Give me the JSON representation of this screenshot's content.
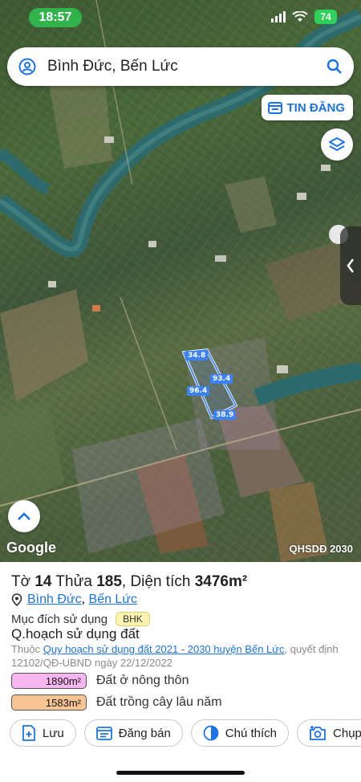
{
  "status_bar": {
    "time": "18:57",
    "battery": "74"
  },
  "search": {
    "value": "Bình Đức, Bến Lức"
  },
  "map": {
    "tin_dang_label": "TIN ĐĂNG",
    "google_label": "Google",
    "layer_label": "QHSDĐ 2030",
    "edge_labels": [
      "34.8",
      "93.4",
      "96.4",
      "38.9"
    ],
    "colors": {
      "accent": "#1a73e8",
      "parcel_outline": "#3b82f6",
      "river": "#2d6a6e"
    }
  },
  "parcel": {
    "title_prefix": "Tờ ",
    "sheet": "14",
    "title_mid": " Thửa ",
    "lot": "185",
    "title_area_prefix": ", Diện tích ",
    "area": "3476m²",
    "commune": "Bình Đức",
    "separator": ", ",
    "district": "Bến Lức",
    "purpose_label": "Mục đích sử dụng",
    "purpose_code": "BHK",
    "qh_title": "Q.hoạch sử dụng đất",
    "qh_prefix": "Thuộc ",
    "qh_link": "Quy hoạch sử dụng đất 2021 - 2030 huyện Bến Lức",
    "qh_suffix": ", quyết định 12102/QĐ-UBND ngày 22/12/2022",
    "land_uses": [
      {
        "area": "1890m²",
        "label": "Đất ở nông thôn",
        "color": "#f7b6f0"
      },
      {
        "area": "1583m²",
        "label": "Đất trồng cây lâu năm",
        "color": "#f7c594"
      }
    ]
  },
  "actions": {
    "save": "Lưu",
    "post_sale": "Đăng bán",
    "legend": "Chú thích",
    "capture": "Chụp"
  }
}
